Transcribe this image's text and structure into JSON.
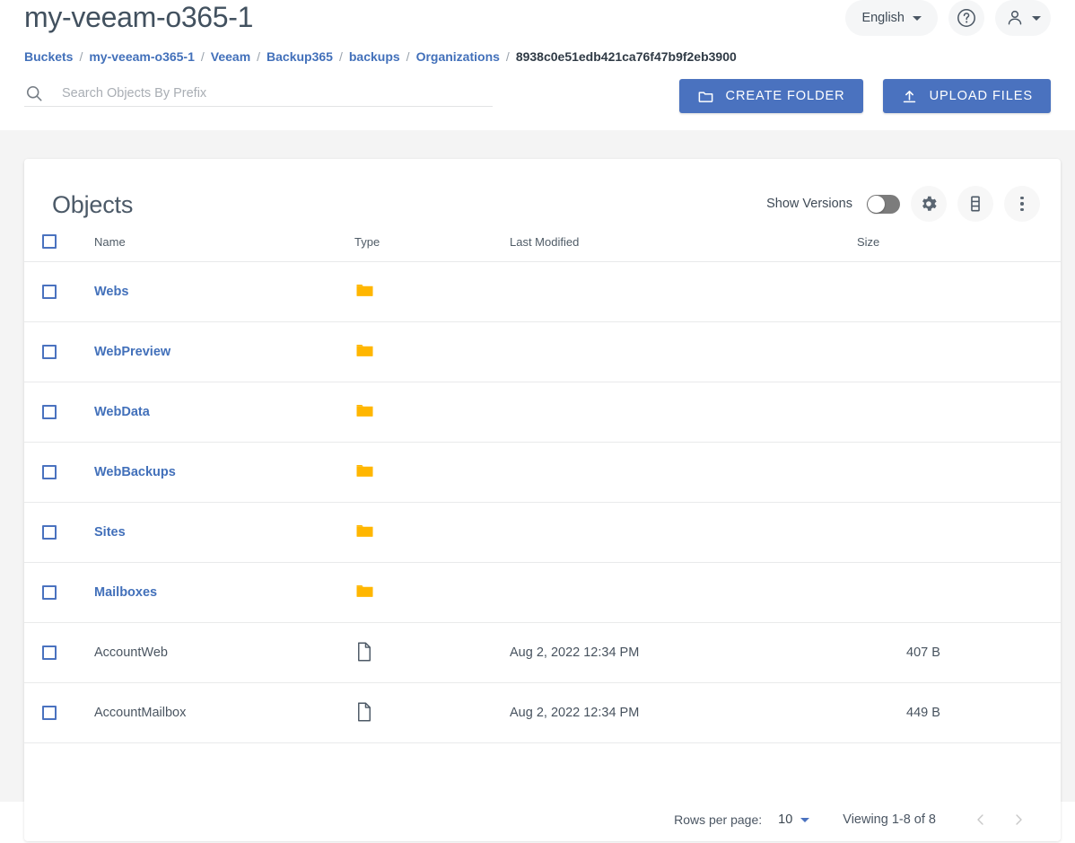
{
  "header": {
    "title": "my-veeam-o365-1",
    "language_button": {
      "label": "English",
      "icon": "chevron-down-icon"
    },
    "help_button": {
      "icon": "help-circle-icon"
    },
    "account_button": {
      "icon": "person-icon",
      "caret": "chevron-down-icon"
    }
  },
  "breadcrumb": {
    "separator": "/",
    "items": [
      {
        "label": "Buckets",
        "link": true
      },
      {
        "label": "my-veeam-o365-1",
        "link": true
      },
      {
        "label": "Veeam",
        "link": true
      },
      {
        "label": "Backup365",
        "link": true
      },
      {
        "label": "backups",
        "link": true
      },
      {
        "label": "Organizations",
        "link": true
      },
      {
        "label": "8938c0e51edb421ca76f47b9f2eb3900",
        "link": false
      }
    ]
  },
  "search": {
    "placeholder": "Search Objects By Prefix",
    "value": "",
    "icon": "search-icon"
  },
  "actions": {
    "create_folder": {
      "label": "CREATE FOLDER",
      "icon": "folder-icon"
    },
    "upload_files": {
      "label": "UPLOAD FILES",
      "icon": "upload-icon"
    }
  },
  "panel": {
    "title": "Objects",
    "show_versions_label": "Show Versions",
    "show_versions_on": false,
    "settings_button": {
      "icon": "gear-icon"
    },
    "storage_button": {
      "icon": "storage-rows-icon"
    },
    "more_button": {
      "icon": "more-vertical-icon"
    }
  },
  "table": {
    "select_all_checkbox": false,
    "columns": [
      "Name",
      "Type",
      "Last Modified",
      "Size"
    ],
    "rows": [
      {
        "name": "Webs",
        "kind": "folder",
        "icon": "folder-icon",
        "modified": "",
        "size": "",
        "checked": false
      },
      {
        "name": "WebPreview",
        "kind": "folder",
        "icon": "folder-icon",
        "modified": "",
        "size": "",
        "checked": false
      },
      {
        "name": "WebData",
        "kind": "folder",
        "icon": "folder-icon",
        "modified": "",
        "size": "",
        "checked": false
      },
      {
        "name": "WebBackups",
        "kind": "folder",
        "icon": "folder-icon",
        "modified": "",
        "size": "",
        "checked": false
      },
      {
        "name": "Sites",
        "kind": "folder",
        "icon": "folder-icon",
        "modified": "",
        "size": "",
        "checked": false
      },
      {
        "name": "Mailboxes",
        "kind": "folder",
        "icon": "folder-icon",
        "modified": "",
        "size": "",
        "checked": false
      },
      {
        "name": "AccountWeb",
        "kind": "file",
        "icon": "document-icon",
        "modified": "Aug 2, 2022 12:34 PM",
        "size": "407 B",
        "checked": false
      },
      {
        "name": "AccountMailbox",
        "kind": "file",
        "icon": "document-icon",
        "modified": "Aug 2, 2022 12:34 PM",
        "size": "449 B",
        "checked": false
      }
    ]
  },
  "pagination": {
    "rows_per_page_label": "Rows per page:",
    "rows_per_page_value": "10",
    "viewing_text": "Viewing 1-8 of 8",
    "prev_icon": "chevron-left-icon",
    "next_icon": "chevron-right-icon",
    "prev_enabled": false,
    "next_enabled": false
  },
  "colors": {
    "accent_blue": "#4a72bf",
    "link_blue": "#4270ba",
    "folder_amber": "#ffb600",
    "text_dark": "#42515f",
    "page_bg": "#f4f4f4",
    "card_bg": "#ffffff"
  }
}
